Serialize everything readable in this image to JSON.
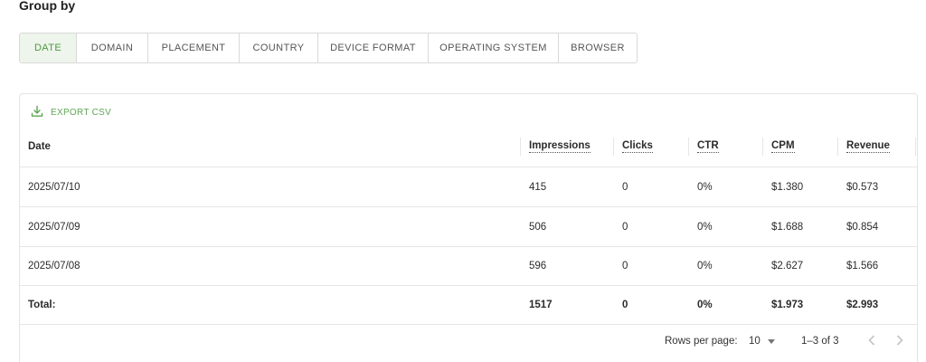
{
  "group_by": {
    "title": "Group by",
    "tabs": [
      {
        "label": "DATE",
        "active": true
      },
      {
        "label": "DOMAIN",
        "active": false
      },
      {
        "label": "PLACEMENT",
        "active": false
      },
      {
        "label": "COUNTRY",
        "active": false
      },
      {
        "label": "DEVICE FORMAT",
        "active": false
      },
      {
        "label": "OPERATING SYSTEM",
        "active": false
      },
      {
        "label": "BROWSER",
        "active": false
      }
    ]
  },
  "table": {
    "export_label": "EXPORT CSV",
    "columns": {
      "date": "Date",
      "impressions": "Impressions",
      "clicks": "Clicks",
      "ctr": "CTR",
      "cpm": "CPM",
      "revenue": "Revenue"
    },
    "rows": [
      {
        "date": "2025/07/10",
        "impressions": "415",
        "clicks": "0",
        "ctr": "0%",
        "cpm": "$1.380",
        "revenue": "$0.573"
      },
      {
        "date": "2025/07/09",
        "impressions": "506",
        "clicks": "0",
        "ctr": "0%",
        "cpm": "$1.688",
        "revenue": "$0.854"
      },
      {
        "date": "2025/07/08",
        "impressions": "596",
        "clicks": "0",
        "ctr": "0%",
        "cpm": "$2.627",
        "revenue": "$1.566"
      }
    ],
    "total": {
      "label": "Total:",
      "impressions": "1517",
      "clicks": "0",
      "ctr": "0%",
      "cpm": "$1.973",
      "revenue": "$2.993"
    }
  },
  "pagination": {
    "rows_per_page_label": "Rows per page:",
    "rows_per_page_value": "10",
    "range": "1–3 of 3"
  },
  "colors": {
    "accent": "#5ea653",
    "active_tab_bg": "#eef5ec",
    "border": "#d9d9d9"
  },
  "icons": {
    "export": "download-icon",
    "select": "caret-down-icon",
    "prev": "chevron-left-icon",
    "next": "chevron-right-icon"
  }
}
